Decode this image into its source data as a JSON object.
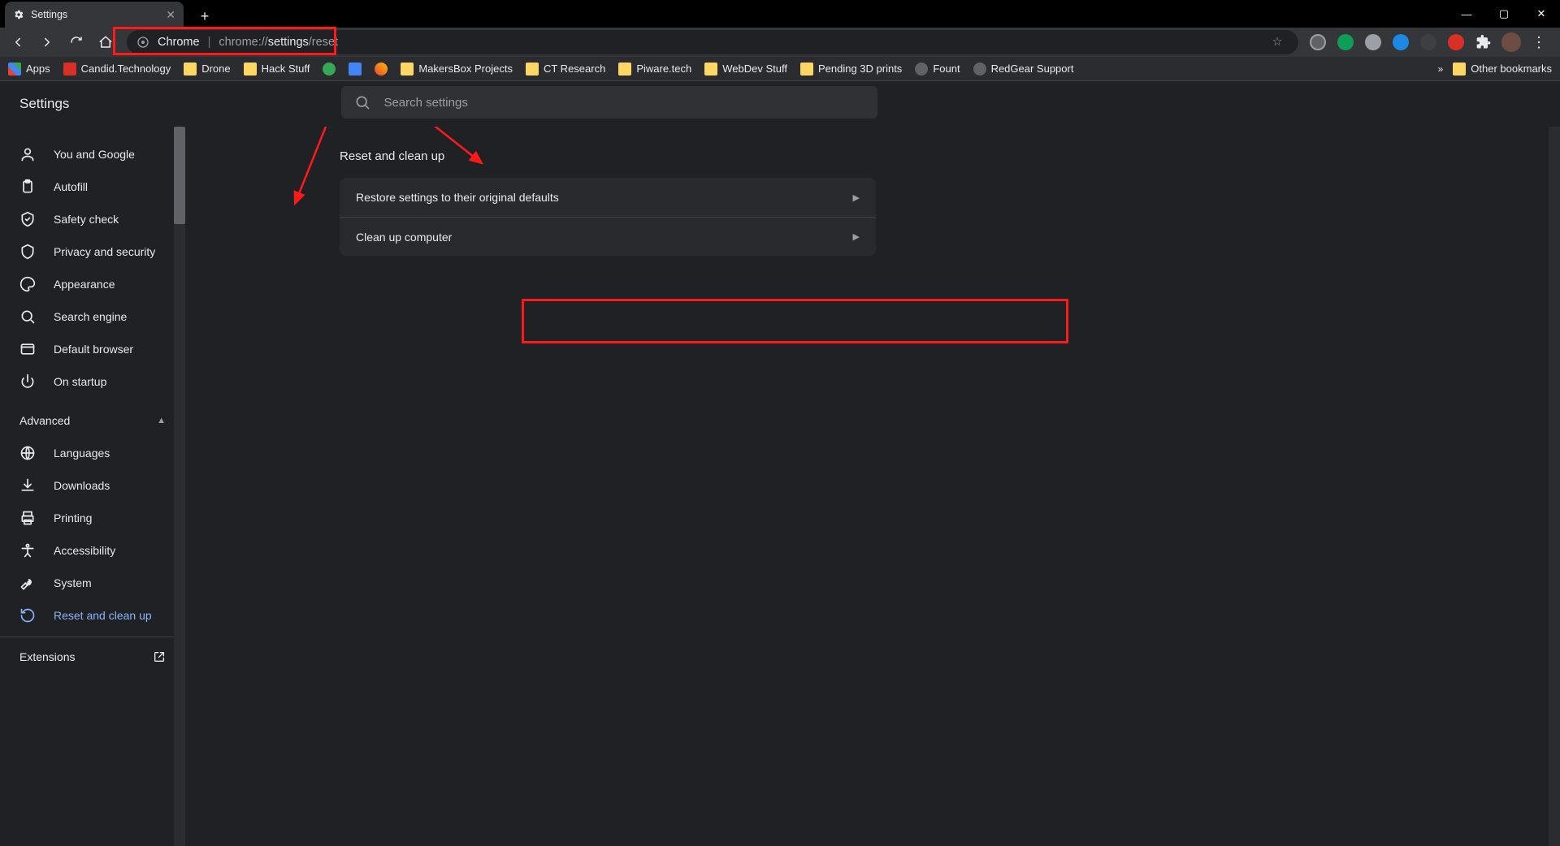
{
  "tab": {
    "title": "Settings"
  },
  "omnibox": {
    "label": "Chrome",
    "url_dim1": "chrome://",
    "url_lit": "settings",
    "url_dim2": "/reset"
  },
  "bookmarks": {
    "apps": "Apps",
    "items": [
      "Candid.Technology",
      "Drone",
      "Hack Stuff",
      "",
      "",
      "MakersBox Projects",
      "CT Research",
      "Piware.tech",
      "WebDev Stuff",
      "Pending 3D prints",
      "Fount",
      "RedGear Support"
    ],
    "other": "Other bookmarks"
  },
  "header": {
    "title": "Settings"
  },
  "search": {
    "placeholder": "Search settings"
  },
  "sidebar": {
    "basic": [
      {
        "icon": "person",
        "label": "You and Google"
      },
      {
        "icon": "clipboard",
        "label": "Autofill"
      },
      {
        "icon": "shield-check",
        "label": "Safety check"
      },
      {
        "icon": "shield",
        "label": "Privacy and security"
      },
      {
        "icon": "palette",
        "label": "Appearance"
      },
      {
        "icon": "search",
        "label": "Search engine"
      },
      {
        "icon": "browser",
        "label": "Default browser"
      },
      {
        "icon": "power",
        "label": "On startup"
      }
    ],
    "advanced_label": "Advanced",
    "advanced": [
      {
        "icon": "globe",
        "label": "Languages"
      },
      {
        "icon": "download",
        "label": "Downloads"
      },
      {
        "icon": "print",
        "label": "Printing"
      },
      {
        "icon": "accessibility",
        "label": "Accessibility"
      },
      {
        "icon": "wrench",
        "label": "System"
      },
      {
        "icon": "restore",
        "label": "Reset and clean up",
        "active": true
      }
    ],
    "extensions": "Extensions"
  },
  "section": {
    "title": "Reset and clean up",
    "rows": [
      {
        "label": "Restore settings to their original defaults"
      },
      {
        "label": "Clean up computer"
      }
    ]
  }
}
